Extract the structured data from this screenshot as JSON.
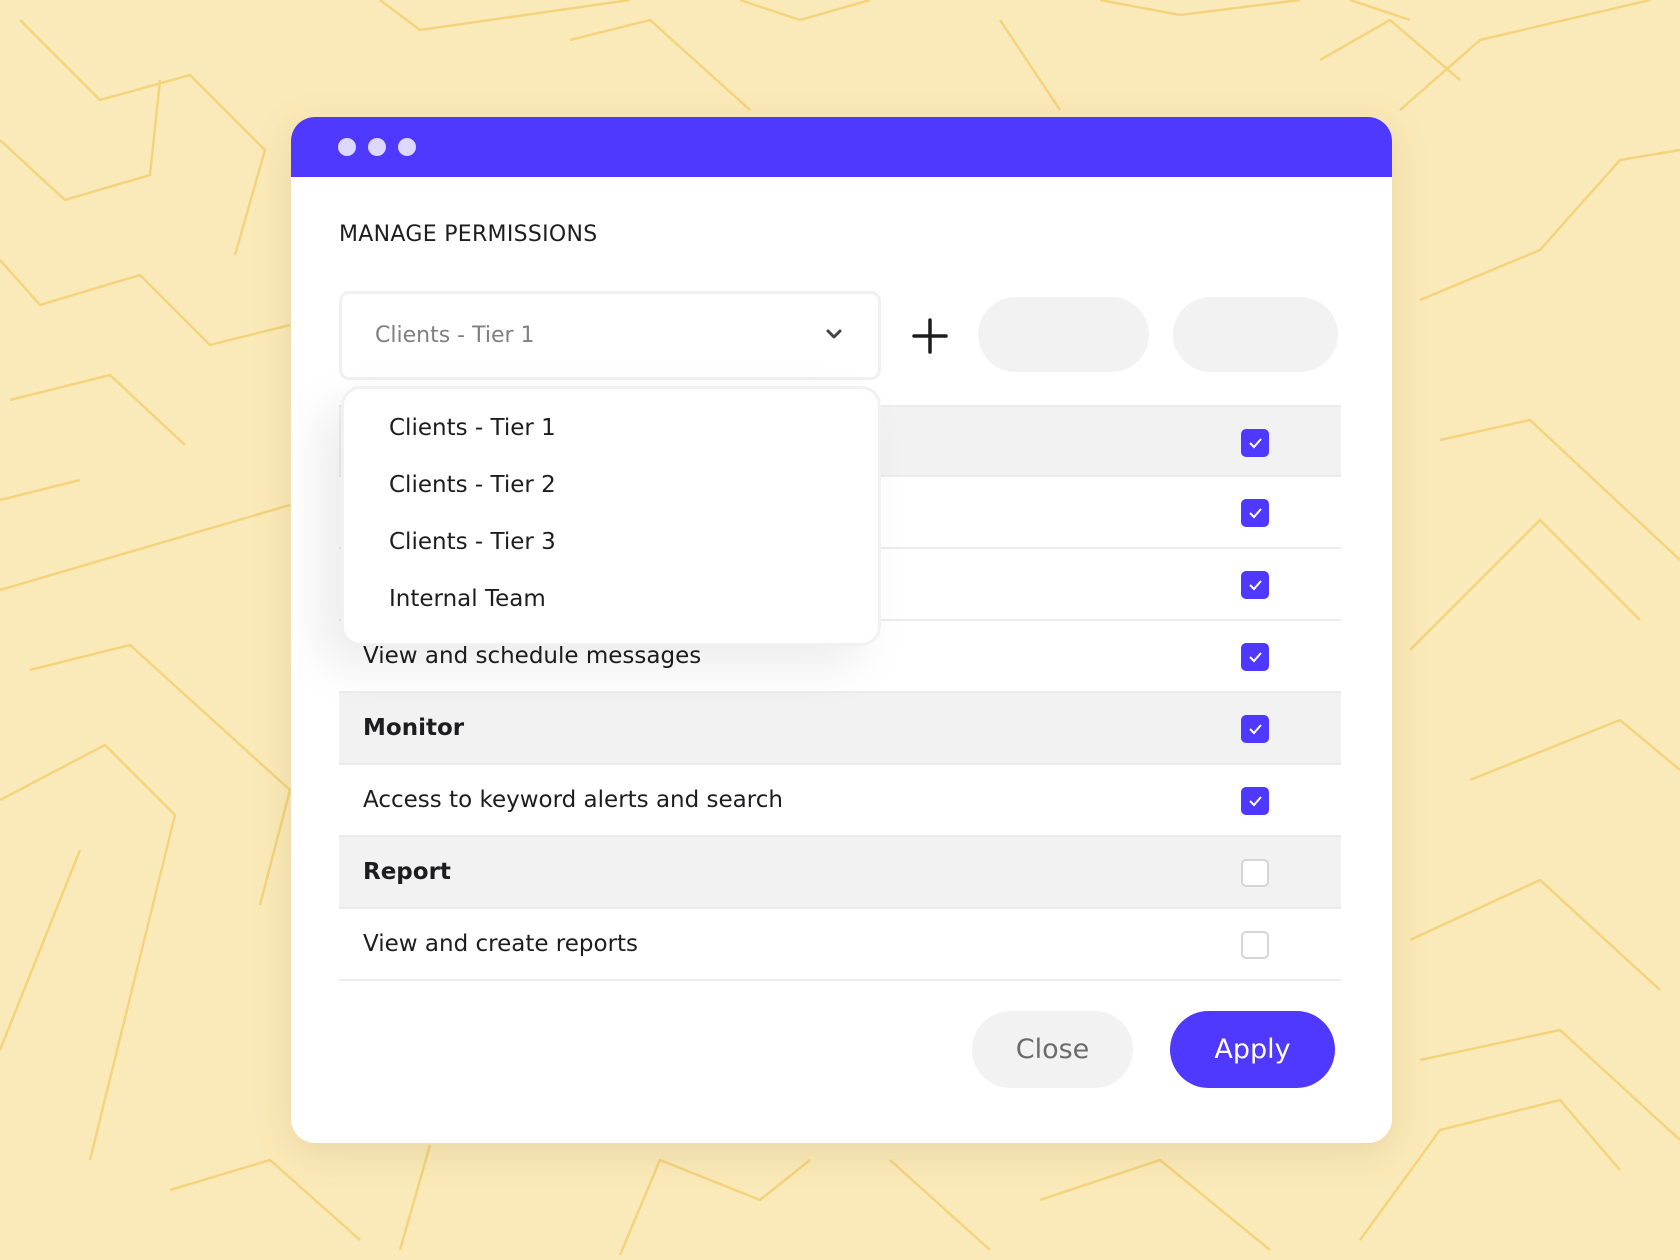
{
  "window": {
    "controls": [
      "dot",
      "dot",
      "dot"
    ],
    "accent": "#4f38ff",
    "background": "#fbeab9"
  },
  "dialog": {
    "title": "MANAGE PERMISSIONS",
    "select": {
      "value": "Clients - Tier 1",
      "icon": "chevron-down-icon"
    },
    "add_icon": "plus-icon",
    "menu": {
      "options": [
        "Clients - Tier 1",
        "Clients - Tier 2",
        "Clients - Tier 3",
        "Internal Team"
      ]
    },
    "rows": [
      {
        "label": "",
        "group": true,
        "checked": true
      },
      {
        "label": "",
        "group": false,
        "checked": true
      },
      {
        "label": "",
        "group": false,
        "checked": true
      },
      {
        "label": "View and schedule messages",
        "group": false,
        "checked": true
      },
      {
        "label": "Monitor",
        "group": true,
        "checked": true
      },
      {
        "label": "Access to keyword alerts and search",
        "group": false,
        "checked": true
      },
      {
        "label": "Report",
        "group": true,
        "checked": false
      },
      {
        "label": "View and create reports",
        "group": false,
        "checked": false
      }
    ],
    "close_label": "Close",
    "apply_label": "Apply"
  }
}
